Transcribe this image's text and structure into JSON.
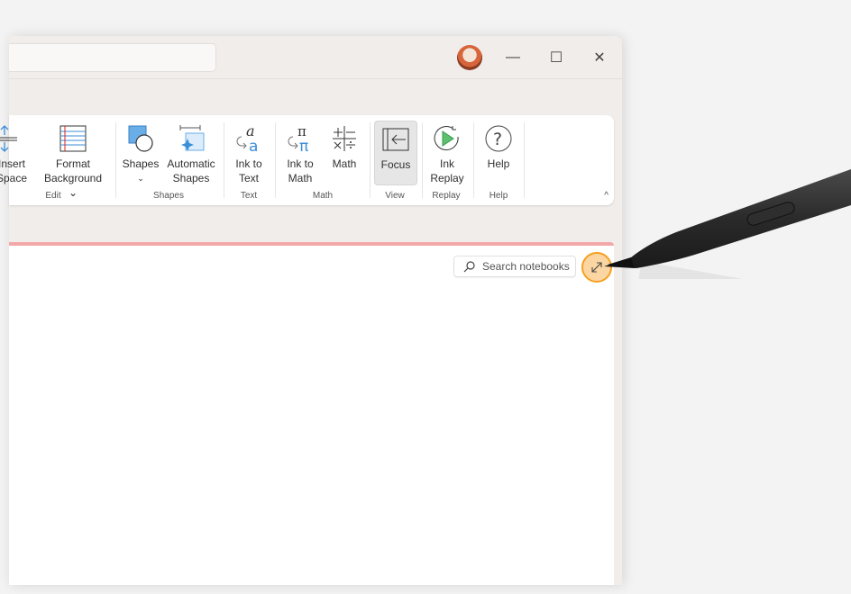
{
  "window": {
    "controls": {
      "minimize": "—",
      "maximize": "☐",
      "close": "✕"
    }
  },
  "ribbon": {
    "buttons": [
      {
        "label1": "Insert",
        "label2": "Space",
        "icon": "insert-space-icon"
      },
      {
        "label1": "Format",
        "label2": "Background ⌄",
        "icon": "format-background-icon"
      },
      {
        "label1": "Shapes",
        "label2": "⌄",
        "icon": "shapes-icon"
      },
      {
        "label1": "Automatic",
        "label2": "Shapes",
        "icon": "automatic-shapes-icon"
      },
      {
        "label1": "Ink to",
        "label2": "Text",
        "icon": "ink-to-text-icon"
      },
      {
        "label1": "Ink to",
        "label2": "Math",
        "icon": "ink-to-math-icon"
      },
      {
        "label1": "Math",
        "label2": "",
        "icon": "math-icon"
      },
      {
        "label1": "Focus",
        "label2": "",
        "icon": "focus-icon",
        "selected": true
      },
      {
        "label1": "Ink",
        "label2": "Replay",
        "icon": "ink-replay-icon"
      },
      {
        "label1": "Help",
        "label2": "",
        "icon": "help-icon"
      }
    ],
    "groups": [
      "Edit",
      "Shapes",
      "Text",
      "Math",
      "View",
      "Replay",
      "Help"
    ],
    "collapse": "^"
  },
  "page": {
    "search_placeholder": "Search notebooks",
    "accent": "#f2a8a8",
    "highlight": "#f5a020"
  }
}
